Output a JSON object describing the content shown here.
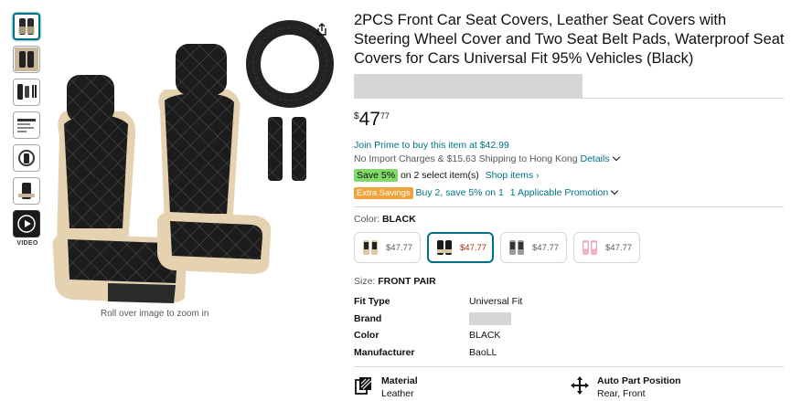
{
  "gallery": {
    "thumbnails": [
      "seat-covers-front",
      "seat-covers-car",
      "seat-cover-parts",
      "size-diagram",
      "features-diagram",
      "installation",
      "video"
    ],
    "video_label": "VIDEO",
    "zoom_hint": "Roll over image to zoom in"
  },
  "product": {
    "title": "2PCS Front Car Seat Covers, Leather Seat Covers with Steering Wheel Cover and Two Seat Belt Pads, Waterproof Seat Covers for Cars Universal Fit 95% Vehicles (Black)",
    "price": {
      "symbol": "$",
      "whole": "47",
      "fraction": "77"
    },
    "prime_offer": "Join Prime to buy this item at $42.99",
    "shipping": "No Import Charges & $15.63 Shipping to Hong Kong",
    "details_link": "Details",
    "save_badge": "Save 5%",
    "save_text": "on 2 select item(s)",
    "shop_items": "Shop items ›",
    "extra_badge": "Extra Savings",
    "extra_text": "Buy 2, save 5% on 1",
    "promotion_link": "1 Applicable Promotion",
    "color_label": "Color:",
    "color_value": "BLACK",
    "swatches": [
      {
        "price": "$47.77",
        "color": "#d9c7a4"
      },
      {
        "price": "$47.77",
        "color": "#1a1a1a"
      },
      {
        "price": "$47.77",
        "color": "#9a9a9a"
      },
      {
        "price": "$47.77",
        "color": "#f0b4c6"
      }
    ],
    "size_label": "Size:",
    "size_value": "FRONT PAIR",
    "specs": [
      {
        "key": "Fit Type",
        "value": "Universal Fit"
      },
      {
        "key": "Brand",
        "value": ""
      },
      {
        "key": "Color",
        "value": "BLACK"
      },
      {
        "key": "Manufacturer",
        "value": "BaoLL"
      }
    ],
    "features": [
      {
        "icon": "material-icon",
        "title": "Material",
        "value": "Leather"
      },
      {
        "icon": "auto-part-position-icon",
        "title": "Auto Part Position",
        "value": "Rear, Front"
      }
    ]
  },
  "colors": {
    "link": "#007185",
    "save_green": "#7fda69",
    "extra_orange": "#f0a33a",
    "price_red": "#b12704"
  }
}
